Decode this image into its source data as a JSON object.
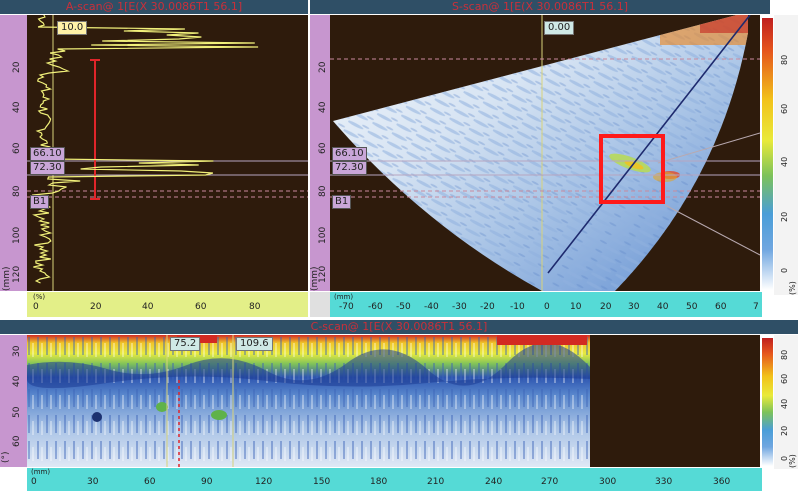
{
  "a_scan": {
    "title": "A-scan@ 1[E(X 30.0086T1 56.1]",
    "gate_value": "10.0",
    "cursor_labels": [
      "66.10",
      "72.30",
      "B1"
    ],
    "y_ticks": [
      "20",
      "40",
      "60",
      "80",
      "100",
      "120"
    ],
    "y_unit": "(mm)",
    "x_ticks": [
      "0",
      "20",
      "40",
      "60",
      "80"
    ],
    "x_unit": "(%)"
  },
  "s_scan": {
    "title": "S-scan@ 1[E(X 30.0086T1 56.1]",
    "gate_value": "0.00",
    "cursor_labels": [
      "66.10",
      "72.30",
      "B1"
    ],
    "y_ticks": [
      "20",
      "40",
      "60",
      "80",
      "100",
      "120"
    ],
    "y_unit": "(mm)",
    "x_ticks": [
      "-70",
      "-60",
      "-50",
      "-40",
      "-30",
      "-20",
      "-10",
      "0",
      "10",
      "20",
      "30",
      "40",
      "50",
      "60",
      "7"
    ],
    "x_unit": "(mm)",
    "colorbar_ticks": [
      "80",
      "60",
      "40",
      "20",
      "0"
    ],
    "colorbar_unit": "(%)"
  },
  "c_scan": {
    "title": "C-scan@ 1[E(X 30.0086T1 56.1]",
    "cursor_values": [
      "75.2",
      "109.6"
    ],
    "y_ticks": [
      "30",
      "40",
      "50",
      "60"
    ],
    "y_unit": "(°)",
    "x_ticks": [
      "0",
      "30",
      "60",
      "90",
      "120",
      "150",
      "180",
      "210",
      "240",
      "270",
      "300",
      "330",
      "360"
    ],
    "x_unit": "(mm)",
    "colorbar_ticks": [
      "80",
      "60",
      "40",
      "20",
      "0"
    ],
    "colorbar_unit": "(%)"
  },
  "colors": {
    "titlebar": "#2f4f66",
    "title_text": "#c9303a",
    "scan_bg": "#2e1b0c",
    "highlight": "#ff1a1a",
    "a_trace": "#f1f07a"
  }
}
